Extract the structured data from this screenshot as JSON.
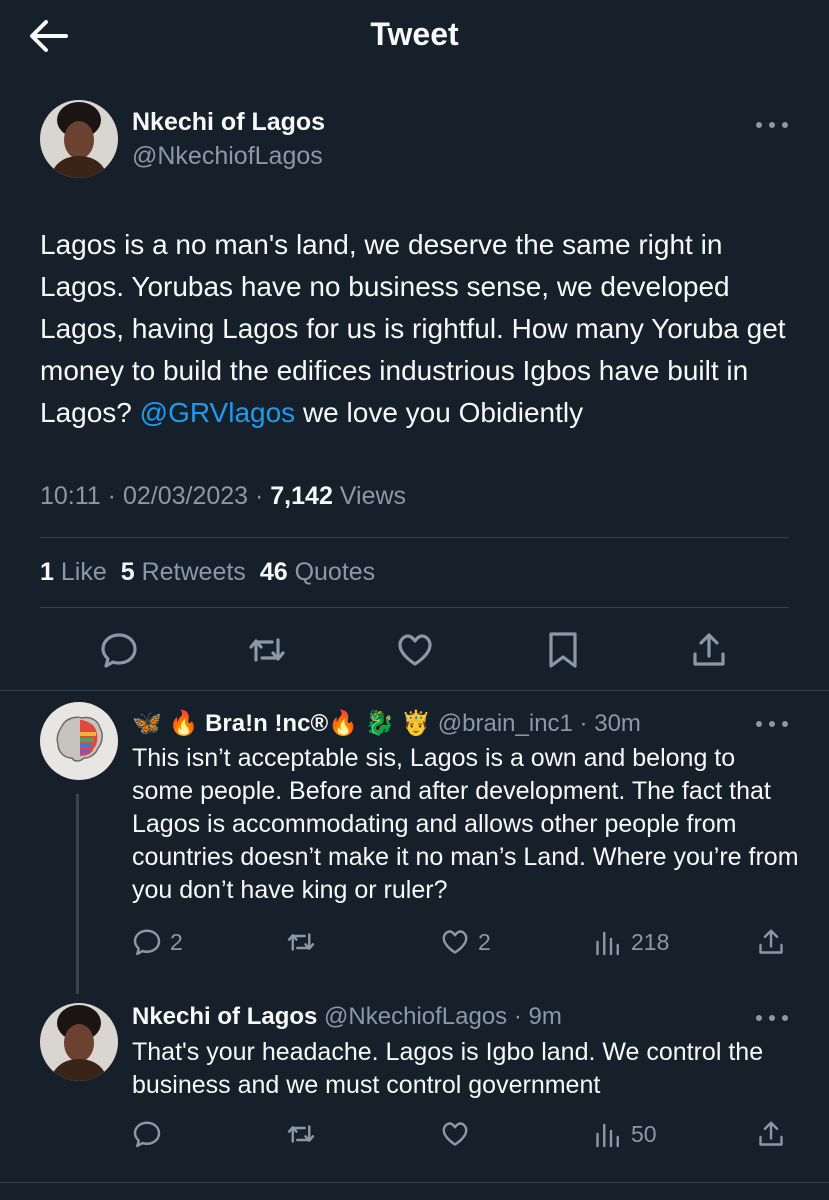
{
  "header": {
    "title": "Tweet"
  },
  "tweet": {
    "author_name": "Nkechi of Lagos",
    "author_handle": "@NkechiofLagos",
    "text_before": "Lagos is a no man's land, we deserve the same right in Lagos. Yorubas have no business sense, we developed Lagos, having Lagos for us is rightful. How many Yoruba get money to build the edifices industrious Igbos have built in Lagos? ",
    "mention": "@GRVlagos",
    "text_after": " we love you Obidiently",
    "time": "10:11",
    "date": "02/03/2023",
    "views_count": "7,142",
    "views_label": "Views",
    "likes_count": "1",
    "likes_label": "Like",
    "retweets_count": "5",
    "retweets_label": "Retweets",
    "quotes_count": "46",
    "quotes_label": "Quotes"
  },
  "replies": [
    {
      "name": "🦋 🔥 Bra!n !nc®🔥 🐉 🤴",
      "handle": "@brain_inc1",
      "time": "30m",
      "text": "This isn’t acceptable sis, Lagos is a own and belong to some people. Before and after development. The fact that Lagos is accommodating and allows other people from countries doesn’t make it no man’s Land. Where you’re from you don’t have king or ruler?",
      "replies_count": "2",
      "retweets_count": "",
      "likes_count": "2",
      "views_count": "218"
    },
    {
      "name": "Nkechi of Lagos",
      "handle": "@NkechiofLagos",
      "time": "9m",
      "text": "That's your headache. Lagos is Igbo land. We control the business and we must control government",
      "replies_count": "",
      "retweets_count": "",
      "likes_count": "",
      "views_count": "50"
    }
  ],
  "colors": {
    "background": "#15202b",
    "text": "#f7f9f9",
    "secondary": "#8b98a5",
    "link": "#1d9bf0",
    "divider": "#38444d"
  },
  "icons": [
    "back-arrow-icon",
    "more-icon",
    "reply-icon",
    "retweet-icon",
    "like-icon",
    "bookmark-icon",
    "share-icon",
    "views-icon"
  ]
}
